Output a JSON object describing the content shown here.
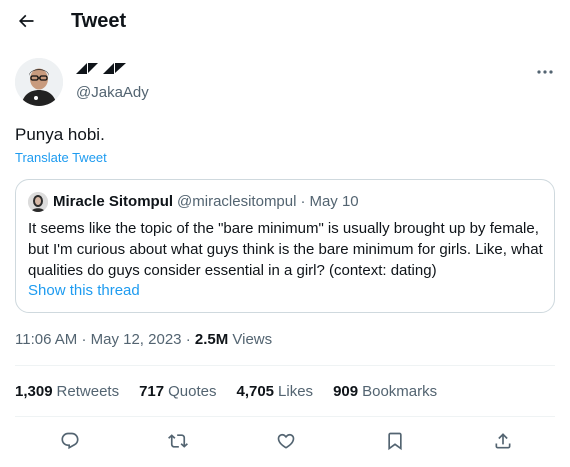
{
  "header": {
    "title": "Tweet",
    "back_icon": "arrow-left-icon"
  },
  "tweet": {
    "author": {
      "display_name": "◢◤◢◤",
      "handle": "@JakaAdy",
      "avatar": "avatar"
    },
    "text": "Punya hobi.",
    "translate_label": "Translate Tweet",
    "more_icon": "more-horizontal-icon"
  },
  "quote": {
    "name": "Miracle Sitompul",
    "handle": "@miraclesitompul",
    "separator": "·",
    "date": "May 10",
    "text": "It seems like the topic of the \"bare minimum\" is usually brought up by female, but I'm curious about what guys think is the bare minimum for girls. Like, what qualities do guys consider essential in a girl? (context: dating)",
    "thread_link": "Show this thread"
  },
  "meta": {
    "time": "11:06 AM",
    "dot1": "·",
    "date": "May 12, 2023",
    "dot2": "·",
    "views_count": "2.5M",
    "views_label": "Views"
  },
  "stats": [
    {
      "count": "1,309",
      "label": "Retweets"
    },
    {
      "count": "717",
      "label": "Quotes"
    },
    {
      "count": "4,705",
      "label": "Likes"
    },
    {
      "count": "909",
      "label": "Bookmarks"
    }
  ],
  "actions": [
    "reply-icon",
    "retweet-icon",
    "like-icon",
    "bookmark-icon",
    "share-icon"
  ],
  "colors": {
    "link": "#1d9bf0",
    "secondary_text": "#536471",
    "border": "#cfd9de",
    "divider": "#eff3f4"
  }
}
